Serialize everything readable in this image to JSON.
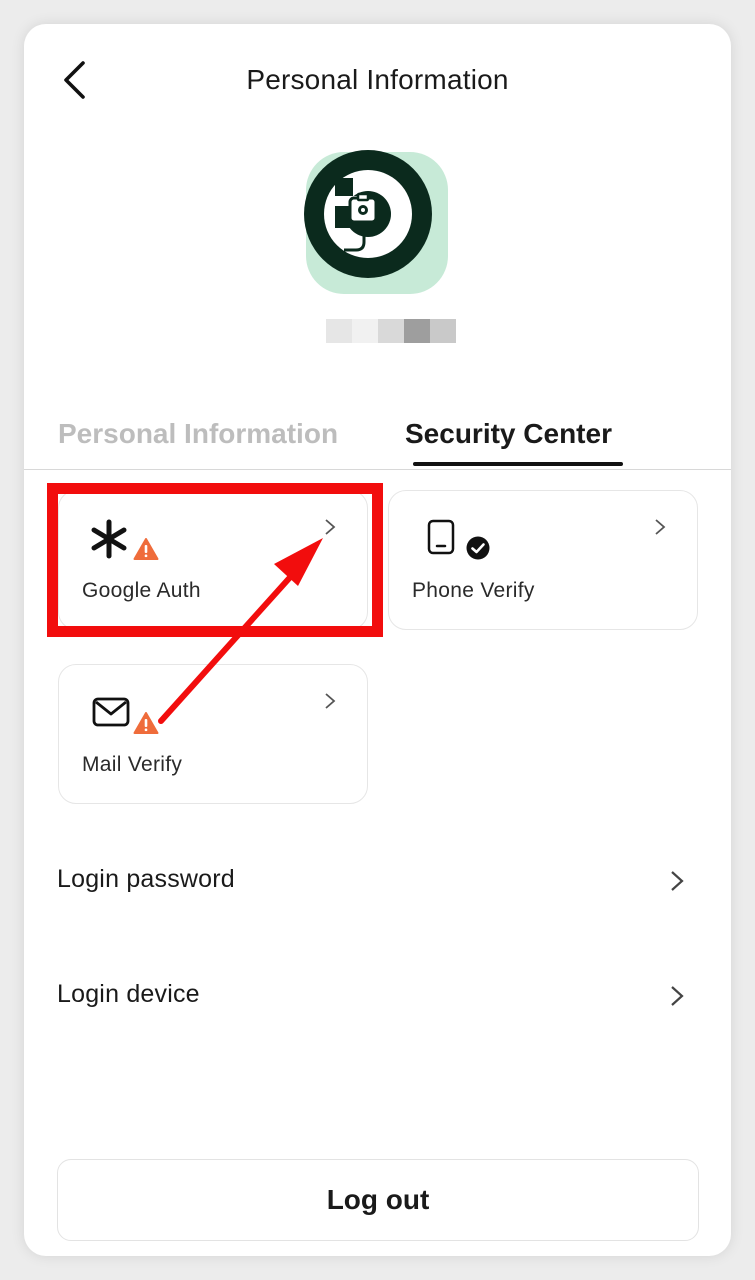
{
  "header": {
    "title": "Personal Information"
  },
  "tabs": [
    {
      "label": "Personal Information",
      "active": false
    },
    {
      "label": "Security Center",
      "active": true
    }
  ],
  "security_cards": [
    {
      "label": "Google Auth",
      "icon": "asterisk-icon",
      "status": "warning"
    },
    {
      "label": "Phone Verify",
      "icon": "phone-icon",
      "status": "verified"
    },
    {
      "label": "Mail Verify",
      "icon": "mail-icon",
      "status": "warning"
    }
  ],
  "list": [
    {
      "label": "Login password"
    },
    {
      "label": "Login device"
    }
  ],
  "logout_label": "Log out",
  "colors": {
    "accent_highlight": "#f20d0d",
    "warning": "#ef6c3b",
    "avatar_bg": "#c7ead7",
    "avatar_dark": "#0b2a1d"
  }
}
